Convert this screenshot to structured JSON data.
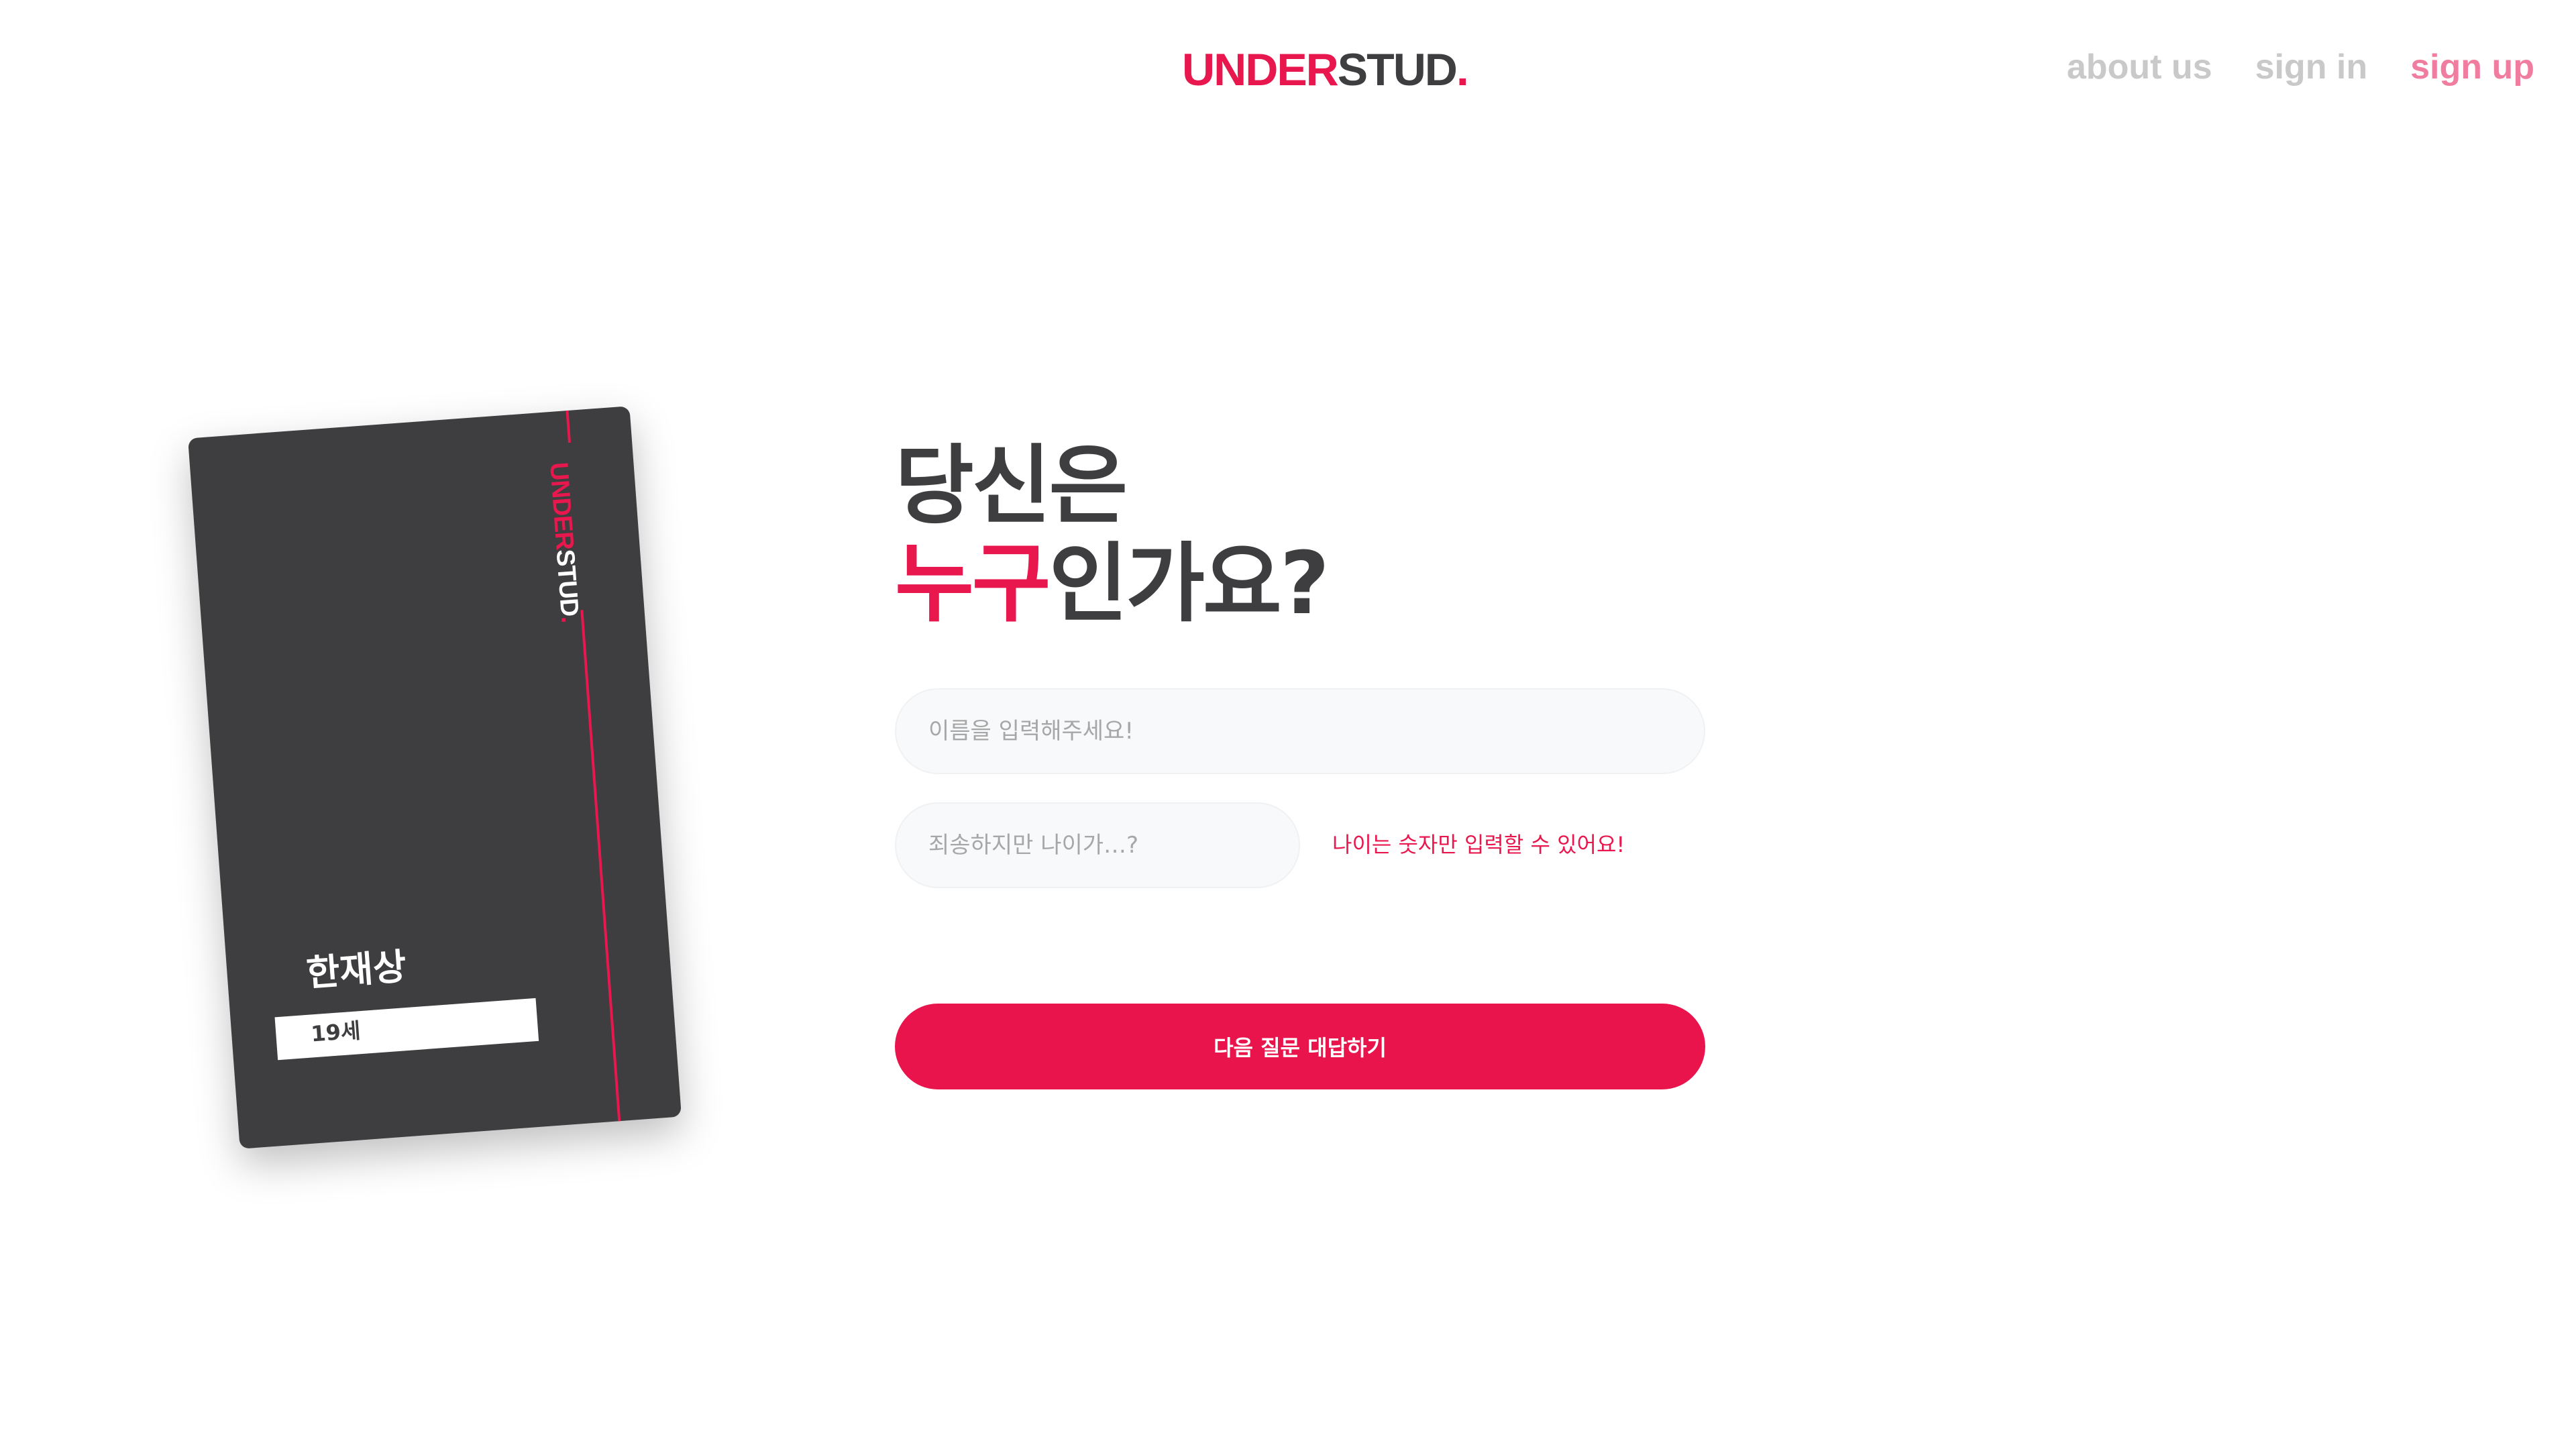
{
  "header": {
    "logo": {
      "part_accent": "UNDER",
      "part_main": "STUD",
      "dot": "."
    },
    "nav": [
      {
        "label": "about us"
      },
      {
        "label": "sign in"
      },
      {
        "label": "sign up"
      }
    ]
  },
  "card": {
    "brand": {
      "part_accent": "UNDER",
      "part_main": "STUD",
      "dot": "."
    },
    "name": "한재상",
    "age": "19세"
  },
  "question": {
    "line1": "당신은",
    "line2_accent": "누구",
    "line2_rest": "인가요?"
  },
  "form": {
    "name_placeholder": "이름을 입력해주세요!",
    "name_value": "",
    "age_placeholder": "죄송하지만 나이가…?",
    "age_value": "",
    "age_warning": "나이는 숫자만 입력할 수 있어요!",
    "submit_label": "다음 질문 대답하기"
  },
  "colors": {
    "accent": "#e8174d",
    "text_dark": "#3e3e40",
    "nav_muted": "#c9c9c9",
    "nav_active": "#f07da0",
    "input_bg": "#f8f9fa"
  }
}
